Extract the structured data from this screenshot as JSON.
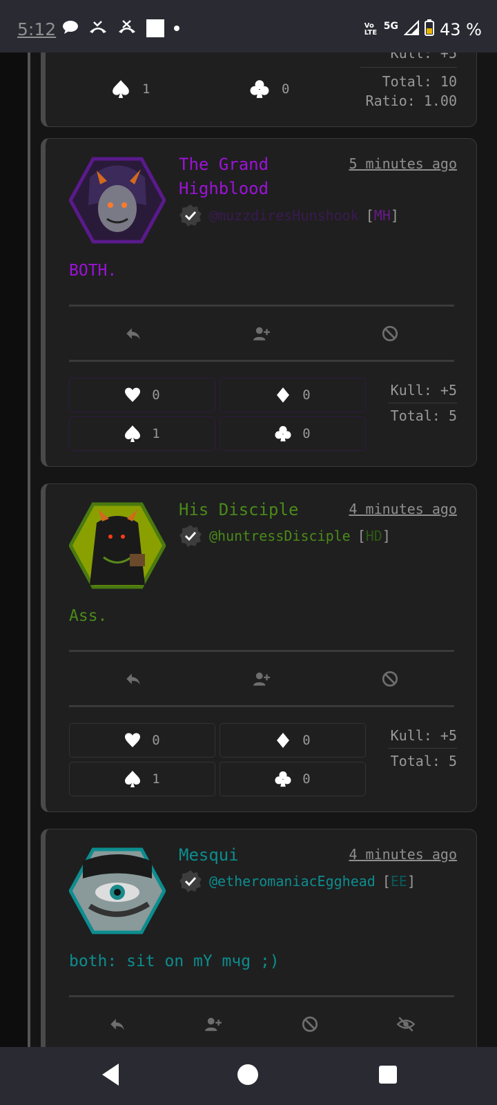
{
  "status_bar": {
    "time": "5:12",
    "network_small": "Vo LTE",
    "network": "5G",
    "battery": "43 %"
  },
  "colors": {
    "purple": "#9d12d9",
    "green": "#4a8a1a",
    "teal": "#0d8d8f"
  },
  "top_card": {
    "spades": "1",
    "clubs": "0",
    "kull": "Kull: +5",
    "total": "Total: 10",
    "ratio": "Ratio: 1.00"
  },
  "posts": [
    {
      "name_line1": "The Grand",
      "name_line2": "Highblood",
      "time": "5 minutes ago",
      "handle": "@muzzdiresHunshook",
      "initials": "MH",
      "message": "BOTH.",
      "votes": {
        "hearts": "0",
        "diamonds": "0",
        "spades": "1",
        "clubs": "0"
      },
      "kull": "Kull: +5",
      "total": "Total: 5"
    },
    {
      "name_line1": "His Disciple",
      "time": "4 minutes ago",
      "handle": "@huntressDisciple",
      "initials": "HD",
      "message": "Ass.",
      "votes": {
        "hearts": "0",
        "diamonds": "0",
        "spades": "1",
        "clubs": "0"
      },
      "kull": "Kull: +5",
      "total": "Total: 5"
    },
    {
      "name_line1": "Mesqui",
      "time": "4 minutes ago",
      "handle": "@etheromaniacEgghead",
      "initials": "EE",
      "message": "both: sit on mY mчg ;)"
    }
  ]
}
